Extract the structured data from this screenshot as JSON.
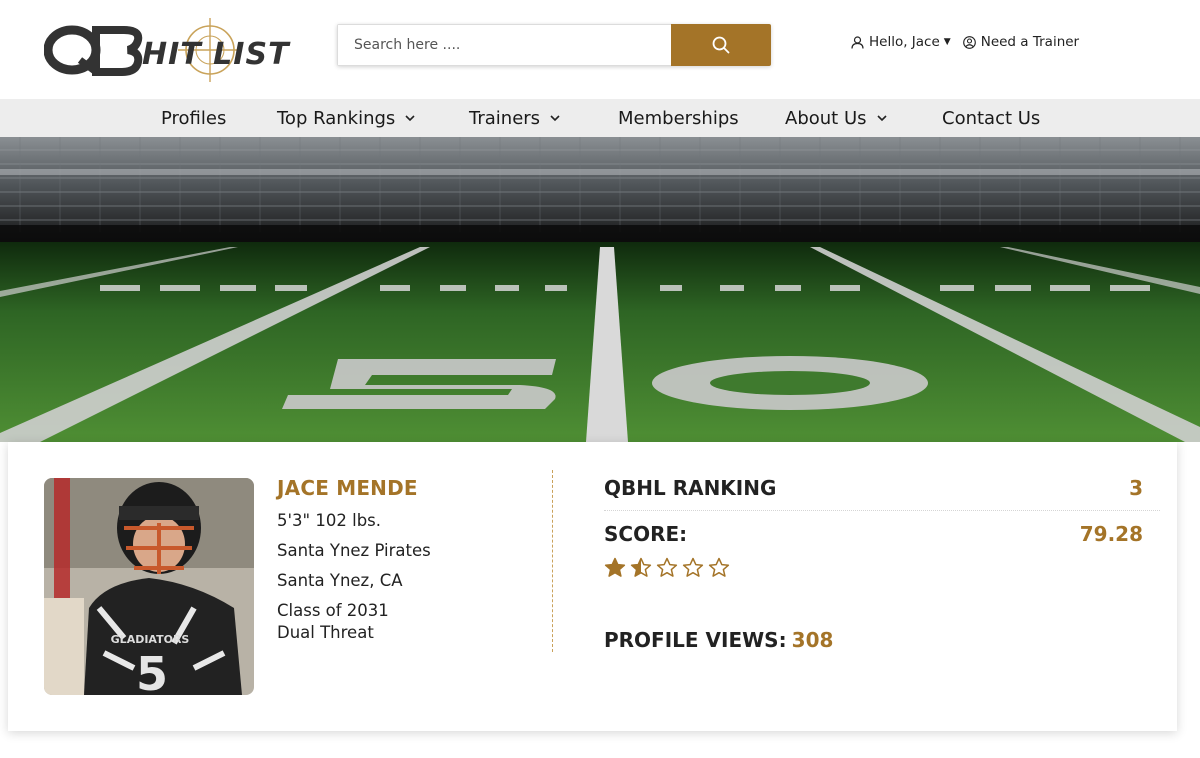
{
  "header": {
    "logo_text": "QBHIT LIST",
    "search": {
      "placeholder": "Search here ....",
      "value": ""
    },
    "user_greeting": "Hello, Jace",
    "trainer_link": "Need a Trainer"
  },
  "nav": {
    "items": [
      {
        "label": "Profiles",
        "dropdown": false
      },
      {
        "label": "Top Rankings",
        "dropdown": true
      },
      {
        "label": "Trainers",
        "dropdown": true
      },
      {
        "label": "Memberships",
        "dropdown": false
      },
      {
        "label": "About Us",
        "dropdown": true
      },
      {
        "label": "Contact Us",
        "dropdown": false
      }
    ]
  },
  "profile": {
    "name": "JACE MENDE",
    "height_weight": "5'3\" 102 lbs.",
    "team": "Santa Ynez Pirates",
    "location": "Santa Ynez, CA",
    "class_year": "Class of 2031",
    "player_type": "Dual Threat",
    "jersey_text": "GLADIATORS",
    "jersey_number": "5"
  },
  "stats": {
    "ranking_label": "QBHL RANKING",
    "ranking_value": "3",
    "score_label": "SCORE:",
    "score_value": "79.28",
    "rating_stars": 1.5,
    "rating_max": 5,
    "views_label": "PROFILE VIEWS:",
    "views_value": "308"
  },
  "colors": {
    "accent": "#a47428",
    "nav_bg": "#ededed",
    "text": "#222222"
  }
}
